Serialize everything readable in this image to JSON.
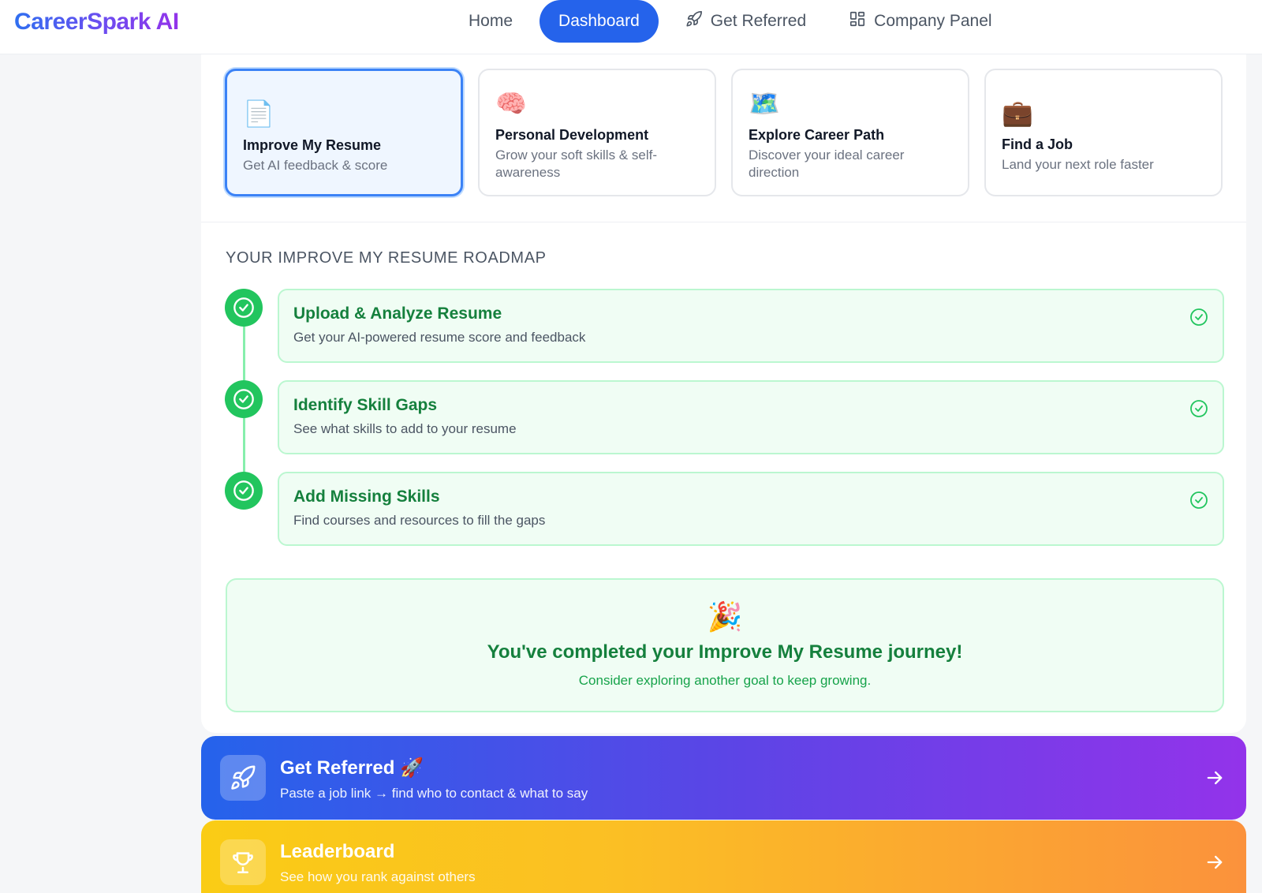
{
  "app": {
    "logo": "CareerSpark AI"
  },
  "nav": {
    "items": [
      {
        "label": "Home",
        "icon": ""
      },
      {
        "label": "Dashboard",
        "icon": "",
        "active": true
      },
      {
        "label": "Get Referred",
        "icon": "rocket-icon"
      },
      {
        "label": "Company Panel",
        "icon": "grid-icon"
      }
    ]
  },
  "goals": [
    {
      "emoji": "📄",
      "title": "Improve My Resume",
      "desc": "Get AI feedback & score",
      "selected": true
    },
    {
      "emoji": "🧠",
      "title": "Personal Development",
      "desc": "Grow your soft skills & self-awareness"
    },
    {
      "emoji": "🗺️",
      "title": "Explore Career Path",
      "desc": "Discover your ideal career direction"
    },
    {
      "emoji": "💼",
      "title": "Find a Job",
      "desc": "Land your next role faster"
    }
  ],
  "roadmap": {
    "title": "YOUR IMPROVE MY RESUME ROADMAP",
    "steps": [
      {
        "title": "Upload & Analyze Resume",
        "desc": "Get your AI-powered resume score and feedback",
        "status": "completed"
      },
      {
        "title": "Identify Skill Gaps",
        "desc": "See what skills to add to your resume",
        "status": "completed"
      },
      {
        "title": "Add Missing Skills",
        "desc": "Find courses and resources to fill the gaps",
        "status": "completed"
      }
    ]
  },
  "completion": {
    "emoji": "🎉",
    "title": "You've completed your Improve My Resume journey!",
    "subtitle": "Consider exploring another goal to keep growing."
  },
  "banners": {
    "referred": {
      "title": "Get Referred 🚀",
      "subtitle": "Paste a job link → find who to contact & what to say"
    },
    "leaderboard": {
      "title": "Leaderboard",
      "subtitle": "See how you rank against others"
    }
  },
  "colors": {
    "primary": "#2563eb",
    "success": "#22c55e",
    "success_text": "#15803d"
  }
}
